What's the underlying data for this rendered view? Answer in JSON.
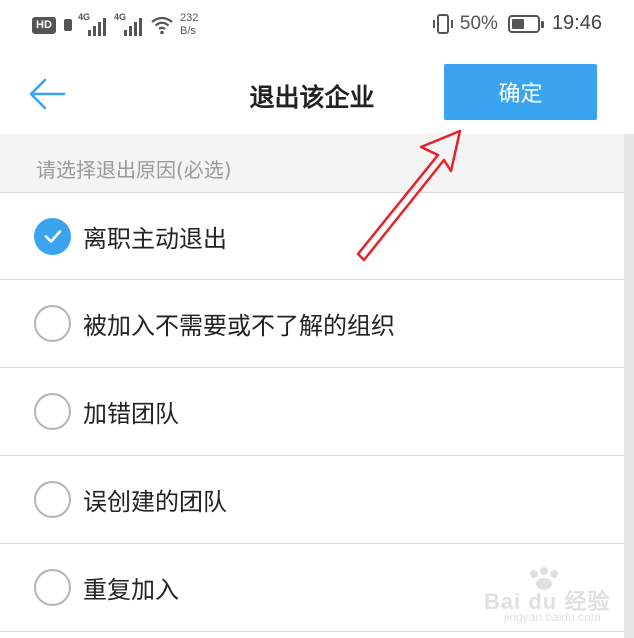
{
  "status_bar": {
    "hd_badge": "HD",
    "network1": "4G",
    "network2": "4G",
    "speed_value": "232",
    "speed_unit": "B/s",
    "battery_percent": "50%",
    "battery_level": 0.5,
    "time": "19:46",
    "icons": [
      "hd-icon",
      "signal-icon",
      "signal-icon",
      "wifi-icon",
      "vibrate-icon",
      "battery-icon"
    ]
  },
  "header": {
    "back_icon": "arrow-left-icon",
    "title": "退出该企业",
    "confirm_label": "确定"
  },
  "section": {
    "caption": "请选择退出原因(必选)"
  },
  "options": [
    {
      "label": "离职主动退出",
      "checked": true
    },
    {
      "label": "被加入不需要或不了解的组织",
      "checked": false
    },
    {
      "label": "加错团队",
      "checked": false
    },
    {
      "label": "误创建的团队",
      "checked": false
    },
    {
      "label": "重复加入",
      "checked": false
    }
  ],
  "watermark": {
    "text": "Bai du 经验",
    "sub": "jingyan.baidu.com"
  },
  "colors": {
    "accent": "#3aa4f0",
    "annotation": "#e8202a",
    "caption_bg": "#f4f4f4"
  }
}
